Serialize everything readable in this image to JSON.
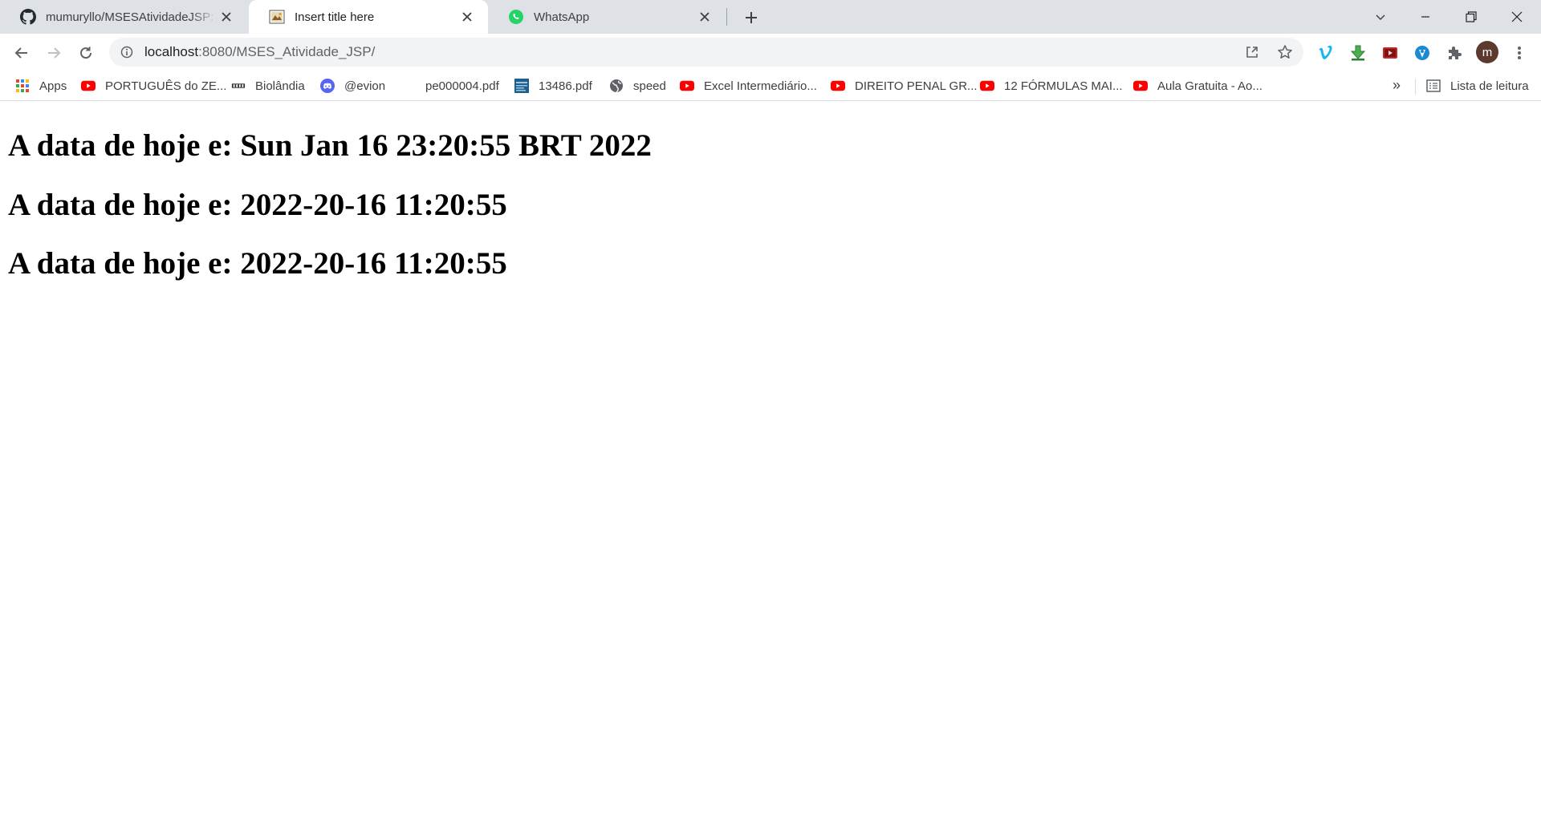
{
  "tabs": [
    {
      "title": "mumuryllo/MSESAtividadeJSP: In",
      "favicon": "github-icon",
      "active": false
    },
    {
      "title": "Insert title here",
      "favicon": "page-icon",
      "active": true
    },
    {
      "title": "WhatsApp",
      "favicon": "whatsapp-icon",
      "active": false
    }
  ],
  "omnibox": {
    "host": "localhost",
    "path": ":8080/MSES_Atividade_JSP/"
  },
  "profile": {
    "initial": "m"
  },
  "bookmarks": [
    {
      "label": "Apps",
      "icon": "apps-grid-icon"
    },
    {
      "label": "PORTUGUÊS do ZE...",
      "icon": "youtube-icon"
    },
    {
      "label": "Biolândia",
      "icon": "biolandia-icon"
    },
    {
      "label": "@evion",
      "icon": "discord-icon"
    },
    {
      "label": "pe000004.pdf",
      "icon": "blank-icon"
    },
    {
      "label": "13486.pdf",
      "icon": "pdf-thumb-icon"
    },
    {
      "label": "speed",
      "icon": "globe-icon"
    },
    {
      "label": "Excel Intermediário...",
      "icon": "youtube-icon"
    },
    {
      "label": "DIREITO PENAL GR...",
      "icon": "youtube-icon"
    },
    {
      "label": "12 FÓRMULAS MAI...",
      "icon": "youtube-icon"
    },
    {
      "label": "Aula Gratuita - Ao...",
      "icon": "youtube-icon"
    }
  ],
  "bookmarks_more": "»",
  "reading_list": {
    "label": "Lista de leitura"
  },
  "page": {
    "lines": [
      "A data de hoje e: Sun Jan 16 23:20:55 BRT 2022",
      "A data de hoje e: 2022-20-16 11:20:55",
      "A data de hoje e: 2022-20-16 11:20:55"
    ]
  },
  "colors": {
    "tabstrip_bg": "#dee1e6",
    "omnibox_bg": "#f1f3f4",
    "youtube_red": "#ff0000",
    "whatsapp_green": "#25d366"
  }
}
